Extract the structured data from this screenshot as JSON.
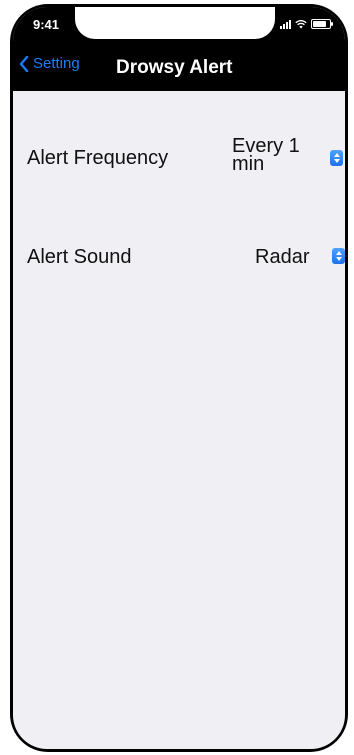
{
  "status_bar": {
    "time": "9:41"
  },
  "nav": {
    "back_label": "Setting",
    "title": "Drowsy Alert"
  },
  "settings": {
    "alert_frequency": {
      "label": "Alert Frequency",
      "value": "Every 1 min"
    },
    "alert_sound": {
      "label": "Alert Sound",
      "value": "Radar"
    }
  },
  "colors": {
    "accent": "#1a7cff",
    "background": "#efeff4",
    "nav_bar": "#000000"
  }
}
